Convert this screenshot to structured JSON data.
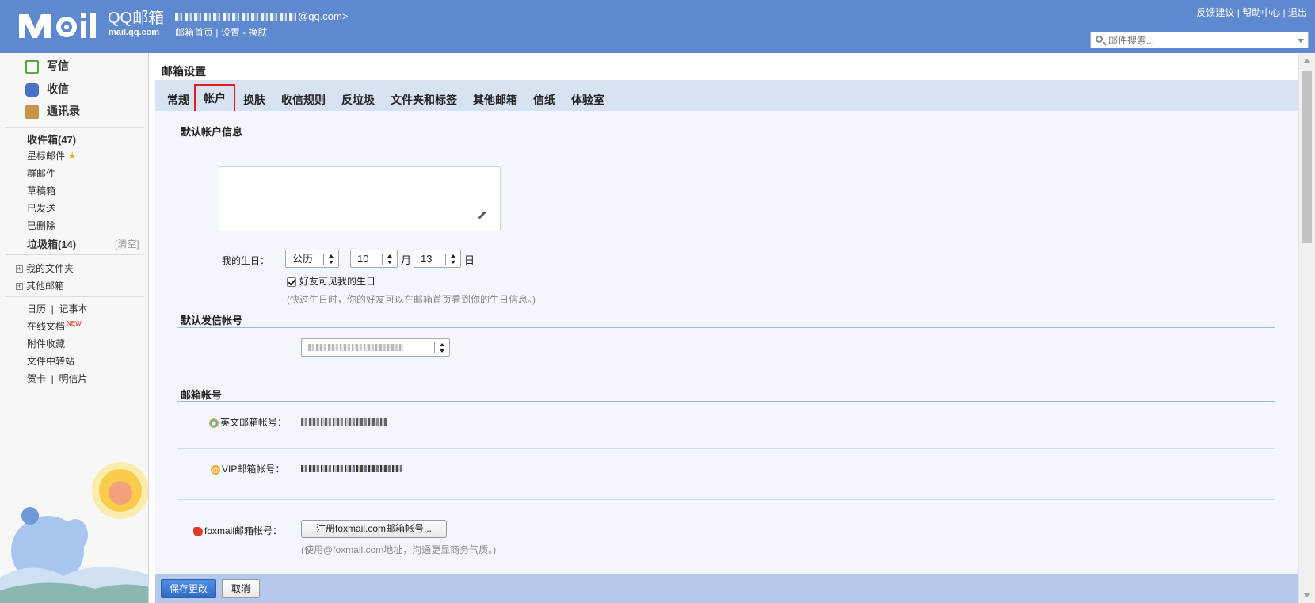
{
  "header": {
    "logo_text": "M il",
    "brand": "QQ邮箱",
    "domain": "mail.qq.com",
    "account_suffix": "@qq.com>",
    "links": [
      "邮箱首页",
      "设置",
      "换肤"
    ],
    "right_links": [
      "反馈建议",
      "帮助中心",
      "退出"
    ],
    "search_placeholder": "邮件搜索..."
  },
  "sidebar": {
    "actions": [
      {
        "label": "写信",
        "color": "#5aa63a"
      },
      {
        "label": "收信",
        "color": "#4a72c4"
      },
      {
        "label": "通讯录",
        "color": "#c9934a"
      }
    ],
    "folders": [
      "收件箱(47)",
      "星标邮件",
      "群邮件",
      "草稿箱",
      "已发送",
      "已删除",
      "垃圾箱(14)"
    ],
    "clear_label": "[清空]",
    "groups": [
      "我的文件夹",
      "其他邮箱"
    ],
    "tools": {
      "calendar": "日历",
      "notepad": "记事本",
      "docs": "在线文档",
      "new_badge": "NEW",
      "attachments": "附件收藏",
      "transfer": "文件中转站",
      "cards": "贺卡",
      "postcards": "明信片"
    }
  },
  "main": {
    "title": "邮箱设置",
    "tabs": [
      "常规",
      "帐户",
      "换肤",
      "收信规则",
      "反垃圾",
      "文件夹和标签",
      "其他邮箱",
      "信纸",
      "体验室"
    ],
    "active_tab": "帐户"
  },
  "account_info": {
    "section_title": "默认帐户信息",
    "birthday_label": "我的生日：",
    "calendar_type": "公历",
    "month": "10",
    "month_unit": "月",
    "day": "13",
    "day_unit": "日",
    "show_friends_label": "好友可见我的生日",
    "show_friends_checked": true,
    "birthday_hint": "(快过生日时，你的好友可以在邮箱首页看到你的生日信息。)"
  },
  "default_sender": {
    "section_title": "默认发信帐号"
  },
  "mailbox_accounts": {
    "section_title": "邮箱帐号",
    "english_label": "英文邮箱帐号：",
    "vip_label": "VIP邮箱帐号：",
    "foxmail_label": "foxmail邮箱帐号：",
    "foxmail_button": "注册foxmail.com邮箱帐号...",
    "foxmail_hint": "(使用@foxmail.com地址，沟通更显商务气质。)"
  },
  "footer": {
    "save": "保存更改",
    "cancel": "取消"
  }
}
